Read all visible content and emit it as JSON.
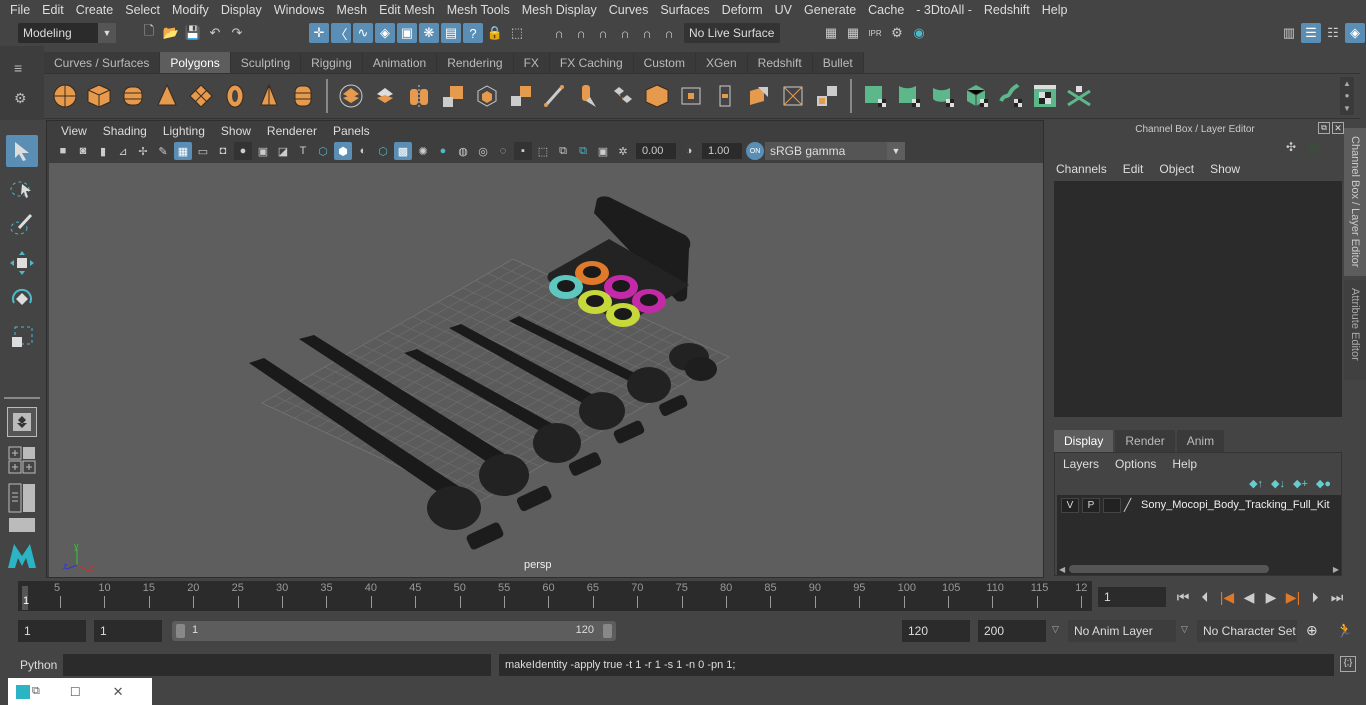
{
  "menubar": [
    "File",
    "Edit",
    "Create",
    "Select",
    "Modify",
    "Display",
    "Windows",
    "Mesh",
    "Edit Mesh",
    "Mesh Tools",
    "Mesh Display",
    "Curves",
    "Surfaces",
    "Deform",
    "UV",
    "Generate",
    "Cache",
    "- 3DtoAll -",
    "Redshift",
    "Help"
  ],
  "toolbar": {
    "workspace": "Modeling",
    "live_surface": "No Live Surface"
  },
  "shelf_tabs": [
    "Curves / Surfaces",
    "Polygons",
    "Sculpting",
    "Rigging",
    "Animation",
    "Rendering",
    "FX",
    "FX Caching",
    "Custom",
    "XGen",
    "Redshift",
    "Bullet"
  ],
  "active_shelf_tab": "Polygons",
  "viewport": {
    "menu": [
      "View",
      "Shading",
      "Lighting",
      "Show",
      "Renderer",
      "Panels"
    ],
    "exposure": "0.00",
    "gamma": "1.00",
    "color_mgmt_toggle": "ON",
    "color_space": "sRGB gamma",
    "camera_label": "persp",
    "axis": {
      "x": "x",
      "y": "y",
      "z": "z"
    }
  },
  "channel_box": {
    "title": "Channel Box / Layer Editor",
    "menu": [
      "Channels",
      "Edit",
      "Object",
      "Show"
    ]
  },
  "layer_editor": {
    "tabs": [
      "Display",
      "Render",
      "Anim"
    ],
    "active_tab": "Display",
    "menu": [
      "Layers",
      "Options",
      "Help"
    ],
    "layers": [
      {
        "v": "V",
        "p": "P",
        "name": "Sony_Mocopi_Body_Tracking_Full_Kit"
      }
    ]
  },
  "side_tabs": [
    "Channel Box / Layer Editor",
    "Attribute Editor"
  ],
  "timeline": {
    "ticks": [
      "5",
      "10",
      "15",
      "20",
      "25",
      "30",
      "35",
      "40",
      "45",
      "50",
      "55",
      "60",
      "65",
      "70",
      "75",
      "80",
      "85",
      "90",
      "95",
      "100",
      "105",
      "110",
      "115",
      "12"
    ],
    "start_marker": "1",
    "current_frame": "1"
  },
  "range": {
    "start": "1",
    "anim_start": "1",
    "slider_start": "1",
    "slider_end": "120",
    "end": "120",
    "anim_end": "200",
    "anim_layer": "No Anim Layer",
    "character_set": "No Character Set"
  },
  "command_line": {
    "language": "Python",
    "input": "",
    "result": "makeIdentity -apply true -t 1 -r 1 -s 1 -n 0 -pn 1;"
  },
  "sensor_colors": [
    "#e07a2a",
    "#5ec8c0",
    "#c42aa8",
    "#c6d83a",
    "#c42aa8",
    "#c6d83a"
  ]
}
